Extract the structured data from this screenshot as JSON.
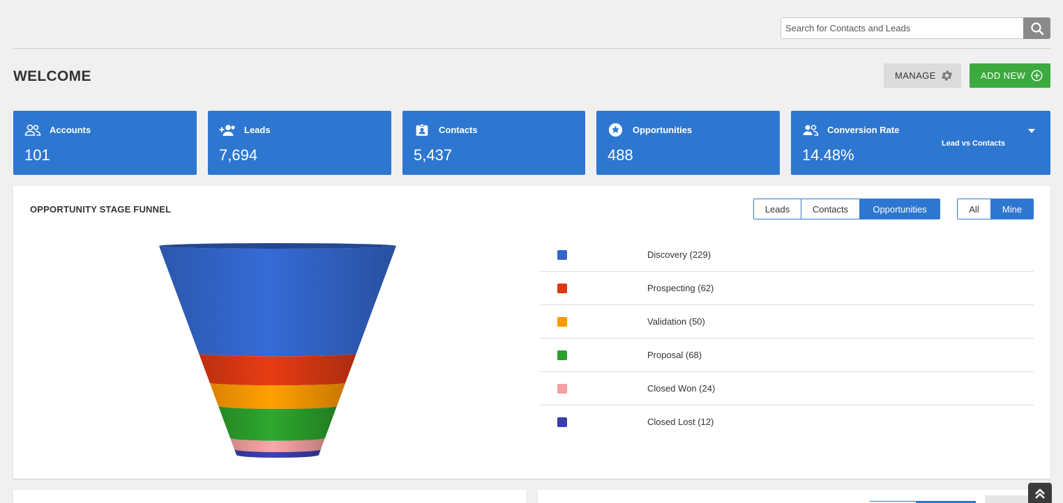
{
  "search": {
    "placeholder": "Search for Contacts and Leads",
    "value": ""
  },
  "header": {
    "title": "WELCOME",
    "manage_label": "MANAGE",
    "add_new_label": "ADD NEW"
  },
  "cards": [
    {
      "label": "Accounts",
      "value": "101",
      "icon": "users-icon"
    },
    {
      "label": "Leads",
      "value": "7,694",
      "icon": "user-plus-icon"
    },
    {
      "label": "Contacts",
      "value": "5,437",
      "icon": "contact-badge-icon"
    },
    {
      "label": "Opportunities",
      "value": "488",
      "icon": "star-circle-icon"
    },
    {
      "label": "Conversion Rate",
      "value": "14.48%",
      "sub": "Lead vs Contacts",
      "icon": "users-icon"
    }
  ],
  "funnel_panel": {
    "title": "OPPORTUNITY STAGE FUNNEL",
    "type_tabs": [
      "Leads",
      "Contacts",
      "Opportunities"
    ],
    "active_type": "Opportunities",
    "owner_tabs": [
      "All",
      "Mine"
    ],
    "active_owner": "Mine"
  },
  "chart_data": {
    "type": "funnel",
    "categories": [
      "Discovery",
      "Prospecting",
      "Validation",
      "Proposal",
      "Closed Won",
      "Closed Lost"
    ],
    "values": [
      229,
      62,
      50,
      68,
      24,
      12
    ],
    "colors": [
      "#3366cc",
      "#dc3912",
      "#ff9900",
      "#2ca02c",
      "#f4a0a0",
      "#3b3eac"
    ],
    "legend_labels": [
      "Discovery (229)",
      "Prospecting (62)",
      "Validation (50)",
      "Proposal (68)",
      "Closed Won (24)",
      "Closed Lost (12)"
    ]
  },
  "colors": {
    "primary": "#2e77d0",
    "success": "#3caa3f",
    "neutral_button": "#dcdcdc"
  }
}
